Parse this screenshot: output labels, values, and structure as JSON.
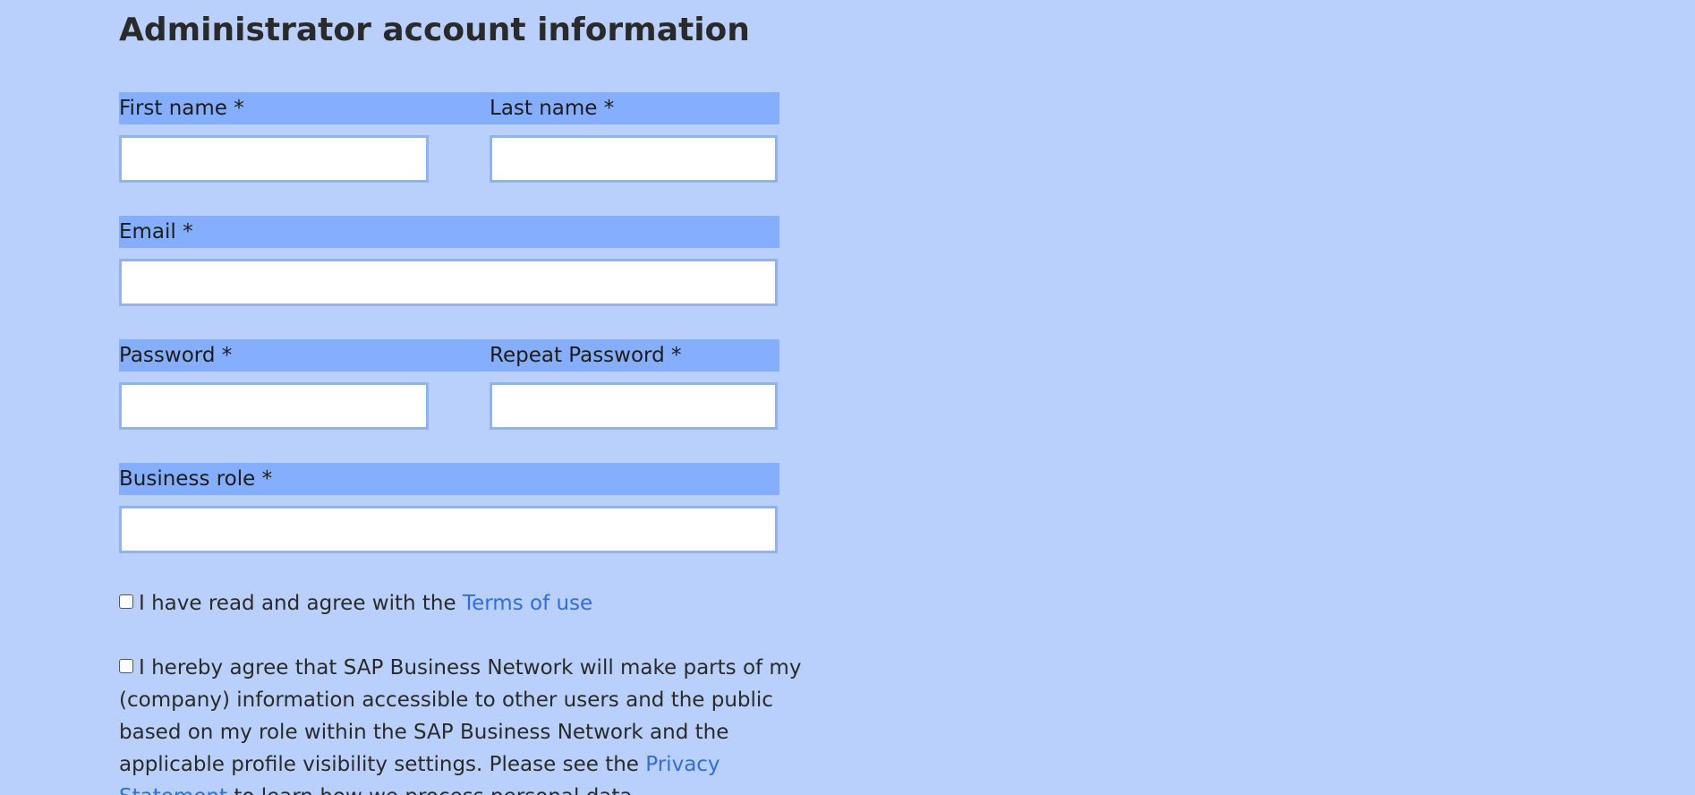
{
  "heading": "Administrator account information",
  "fields": {
    "first_name": {
      "label": "First name *",
      "value": ""
    },
    "last_name": {
      "label": "Last name *",
      "value": ""
    },
    "email": {
      "label": "Email *",
      "value": ""
    },
    "password": {
      "label": "Password *",
      "value": ""
    },
    "repeat_password": {
      "label": "Repeat Password *",
      "value": ""
    },
    "business_role": {
      "label": "Business role *",
      "value": ""
    }
  },
  "terms": {
    "text": "I have read and agree with the",
    "link": "Terms of use",
    "checked": false
  },
  "privacy": {
    "text_before": "I hereby agree that SAP Business Network will make parts of my (company) information accessible to other users and the public based on my role within the SAP Business Network and the applicable profile visibility settings. Please see the",
    "link": "Privacy Statement",
    "text_after": "to learn how we process personal data.",
    "checked": false
  },
  "colors": {
    "background": "#b8d0fb",
    "label_bar": "#86aefe",
    "input_border": "#8fb2f6",
    "link": "#2f6ee0"
  }
}
